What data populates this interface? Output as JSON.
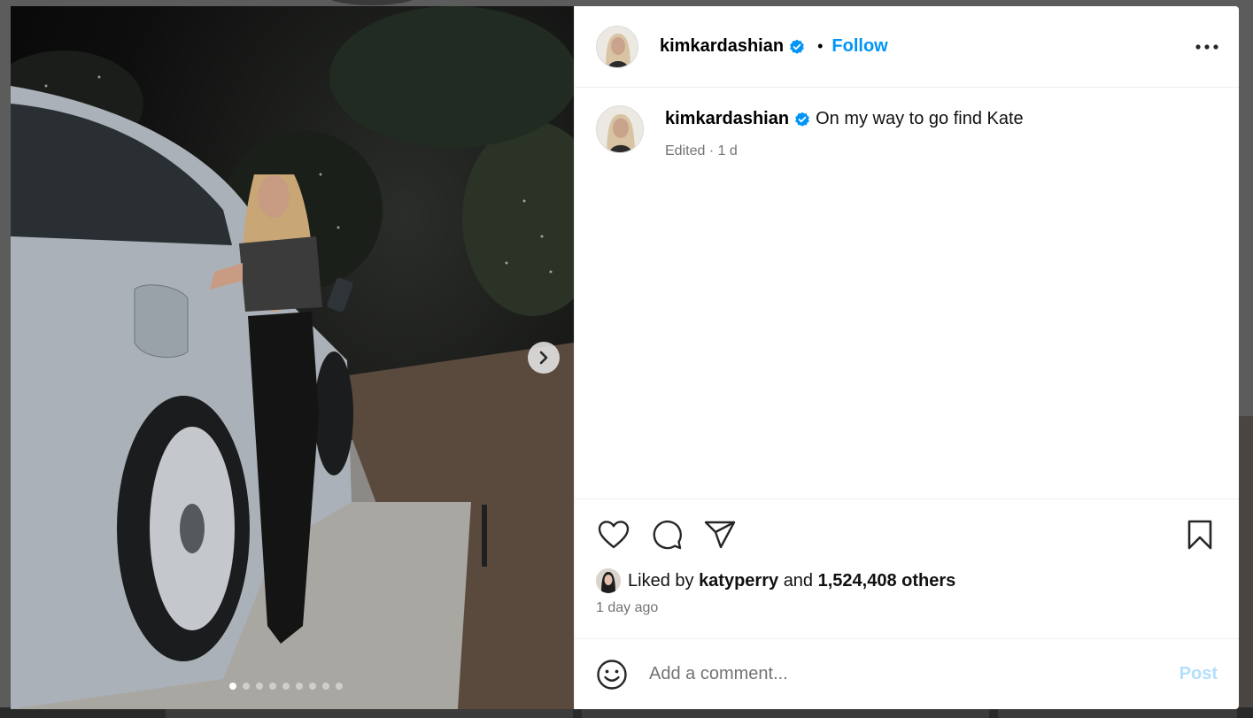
{
  "post": {
    "author": "kimkardashian",
    "follow_label": "Follow",
    "separator": "•",
    "caption": "On my way to go find Kate",
    "meta": "Edited · 1 d",
    "likes_prefix": "Liked by",
    "liker": "katyperry",
    "likes_and": "and",
    "likes_count": "1,524,408 others",
    "time_ago": "1 day ago",
    "carousel_total": 9,
    "carousel_index": 1
  },
  "comment_box": {
    "placeholder": "Add a comment...",
    "post_label": "Post"
  },
  "icons": {
    "verified": "verified-badge-icon",
    "more": "more-options-icon",
    "like": "heart-icon",
    "comment": "comment-bubble-icon",
    "share": "paper-plane-icon",
    "save": "bookmark-icon",
    "emoji": "emoji-smile-icon",
    "next": "chevron-right-icon"
  },
  "colors": {
    "accent": "#0095f6",
    "post_disabled": "#b2dffc",
    "muted": "#737373"
  }
}
